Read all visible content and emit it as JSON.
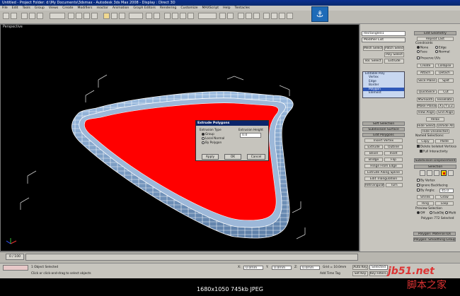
{
  "window": {
    "title": "Untitled - Project Folder: d:\\My Documents\\3dsmax - Autodesk 3ds Max 2008 - Display : Direct 3D"
  },
  "menu": [
    "File",
    "Edit",
    "Tools",
    "Group",
    "Views",
    "Create",
    "Modifiers",
    "reactor",
    "Animation",
    "Graph Editors",
    "Rendering",
    "Customize",
    "MAXScript",
    "Help",
    "Tentacles"
  ],
  "viewport": {
    "label": "Perspective"
  },
  "dialog": {
    "title": "Extrude Polygons",
    "group_type_label": "Extrusion Type",
    "options": [
      "Group",
      "Local Normal",
      "By Polygon"
    ],
    "selected_option": "Group",
    "height_label": "Extrusion Height",
    "height_value": "0.0",
    "buttons": [
      "Apply",
      "OK",
      "Cancel"
    ]
  },
  "panel": {
    "object_name": "Rectangle01",
    "modifier_list": "Modifier List",
    "quick_buttons": [
      "Mesh Select",
      "Patch Select",
      "Poly Select",
      "Vol. Select",
      "Extrude"
    ],
    "stack": [
      "Editable Poly",
      "Vertex",
      "Edge",
      "Border",
      "Polygon",
      "Element"
    ],
    "stack_selected": "Polygon",
    "rollouts": {
      "soft_selection": "Soft Selection",
      "subdivision_surface": "Subdivision Surface",
      "edit_polygons": "Edit Polygons",
      "insert_vertex": "Insert Vertex",
      "polygon_material": "Polygon: Material IDs",
      "smoothing": "Polygon: Smoothing Groups",
      "edit_geometry": "Edit Geometry",
      "subdivision_displacement": "Subdivision Displacement",
      "selection": "Selection"
    },
    "edit_poly_buttons": [
      [
        "Extrude",
        "Outline"
      ],
      [
        "Bevel",
        "Inset"
      ],
      [
        "Bridge",
        "Flip"
      ]
    ],
    "edit_poly_more": [
      "Hinge From Edge",
      "Extrude Along Spline",
      "Edit Triangulation"
    ],
    "edit_poly_last": [
      "Retriangulate",
      "Turn"
    ],
    "edit_geometry": {
      "repeat_last": "Repeat Last",
      "constraints_label": "Constraints",
      "constraints": [
        "None",
        "Edge",
        "Face",
        "Normal"
      ],
      "preserve_uvs": "Preserve UVs",
      "create": "Create",
      "collapse": "Collapse",
      "attach": "Attach",
      "detach": "Detach",
      "slice_plane": "Slice Plane",
      "split": "Split",
      "quickslice": "QuickSlice",
      "cut": "Cut",
      "msmooth": "MSmooth",
      "tessellate": "Tessellate",
      "make_planar": "Make Planar",
      "x": "X",
      "y": "Y",
      "z": "Z",
      "view_align": "View Align",
      "grid_align": "Grid Align",
      "relax": "Relax",
      "hide_selected": "Hide Selected",
      "unhide_all": "Unhide All",
      "hide_unselected": "Hide Unselected",
      "named_selections": "Named Selections:",
      "copy": "Copy",
      "paste": "Paste",
      "delete_isolated": "Delete Isolated Vertices",
      "full_interactivity": "Full Interactivity"
    },
    "selection": {
      "by_vertex": "By Vertex",
      "ignore_backfacing": "Ignore Backfacing",
      "by_angle": "By Angle:",
      "angle_value": "45.0",
      "shrink": "Shrink",
      "grow": "Grow",
      "ring": "Ring",
      "loop": "Loop",
      "preview_label": "Preview Selection",
      "preview_options": [
        "Off",
        "SubObj",
        "Multi"
      ],
      "status": "Polygon 772 Selected"
    }
  },
  "timeline": {
    "frame": "0 / 100"
  },
  "status": {
    "objects": "1 Object Selected",
    "prompt": "Click or click-and-drag to select objects",
    "x_label": "X:",
    "x_value": "0.0mm",
    "y_label": "Y:",
    "y_value": "0.0mm",
    "z_label": "Z:",
    "z_value": "0.0mm",
    "grid": "Grid = 10.0mm",
    "auto_key": "Auto Key",
    "set_key": "Set Key",
    "selected": "Selected",
    "key_filters": "Key Filters...",
    "add_time_tag": "Add Time Tag"
  },
  "footer": {
    "info": "1680x1050  745kb  JPEG"
  },
  "watermark": {
    "site": "jb51.net",
    "cn": "脚本之家"
  },
  "colors": {
    "selected_face": "#ff0000",
    "wire": "#ffffff",
    "mesh": "#8fb0d6",
    "accent": "#0a246a"
  }
}
